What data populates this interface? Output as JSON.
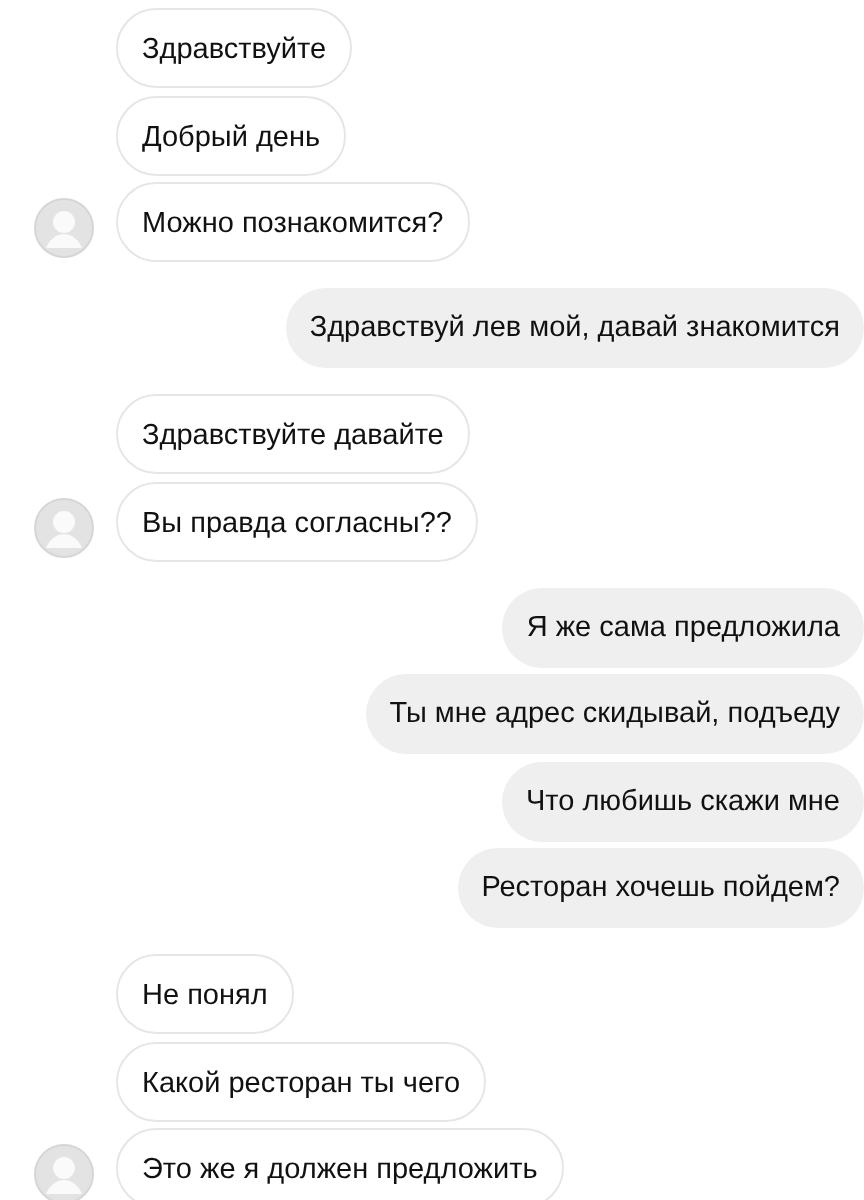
{
  "groups": [
    {
      "kind": "incoming",
      "messages": [
        "Здравствуйте",
        "Добрый день",
        "Можно познакомится?"
      ]
    },
    {
      "kind": "outgoing",
      "messages": [
        "Здравствуй лев мой, давай знакомится"
      ]
    },
    {
      "kind": "incoming",
      "messages": [
        "Здравствуйте давайте",
        "Вы правда согласны??"
      ]
    },
    {
      "kind": "outgoing",
      "messages": [
        "Я же сама предложила",
        "Ты мне адрес скидывай, подъеду",
        "Что любишь скажи мне",
        "Ресторан хочешь пойдем?"
      ]
    },
    {
      "kind": "incoming",
      "messages": [
        "Не понял",
        "Какой ресторан ты чего",
        "Это же я должен предложить"
      ]
    }
  ]
}
